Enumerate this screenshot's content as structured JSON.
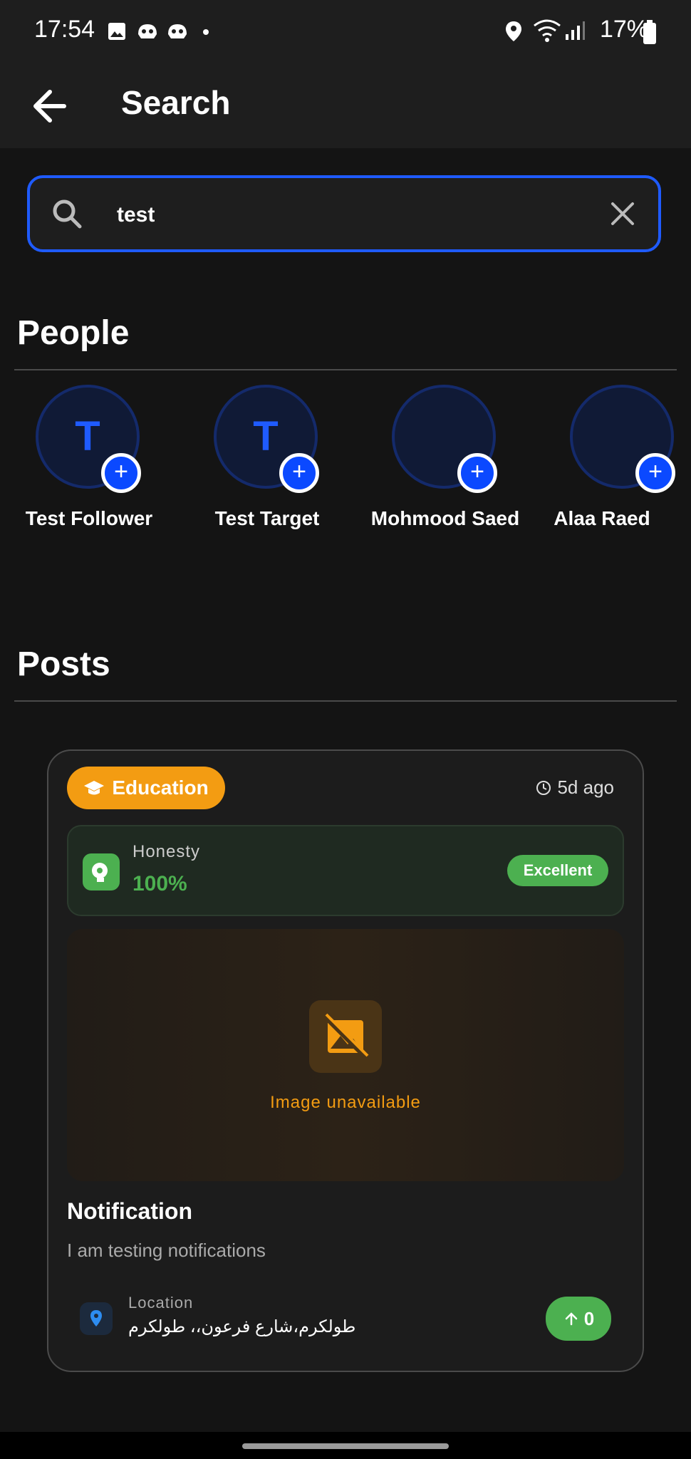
{
  "status_bar": {
    "time": "17:54",
    "battery": "17%"
  },
  "app_bar": {
    "title": "Search"
  },
  "search": {
    "value": "test",
    "placeholder": ""
  },
  "sections": {
    "people": "People",
    "posts": "Posts"
  },
  "people": [
    {
      "initial": "T",
      "name": "Test Follower",
      "follow": "+"
    },
    {
      "initial": "T",
      "name": "Test Target",
      "follow": "+"
    },
    {
      "initial": "",
      "name": "Mohmood Saed",
      "follow": "+"
    },
    {
      "initial": "",
      "name": "Alaa Raed",
      "follow": "+"
    }
  ],
  "post": {
    "category": "Education",
    "time_ago": "5d ago",
    "metric": {
      "label": "Honesty",
      "value": "100%",
      "rating": "Excellent"
    },
    "image_status": "Image unavailable",
    "title": "Notification",
    "body": "I am testing notifications",
    "location": {
      "label": "Location",
      "value": "طولكرم،شارع فرعون،، طولكرم"
    },
    "upvotes": "0"
  },
  "colors": {
    "accent": "#1f5bff",
    "category": "#f39c12",
    "success": "#4cb050"
  },
  "icons": [
    "back-arrow-icon",
    "search-icon",
    "close-icon",
    "graduation-cap-icon",
    "clock-icon",
    "honesty-icon",
    "image-off-icon",
    "location-pin-icon",
    "arrow-up-icon"
  ]
}
